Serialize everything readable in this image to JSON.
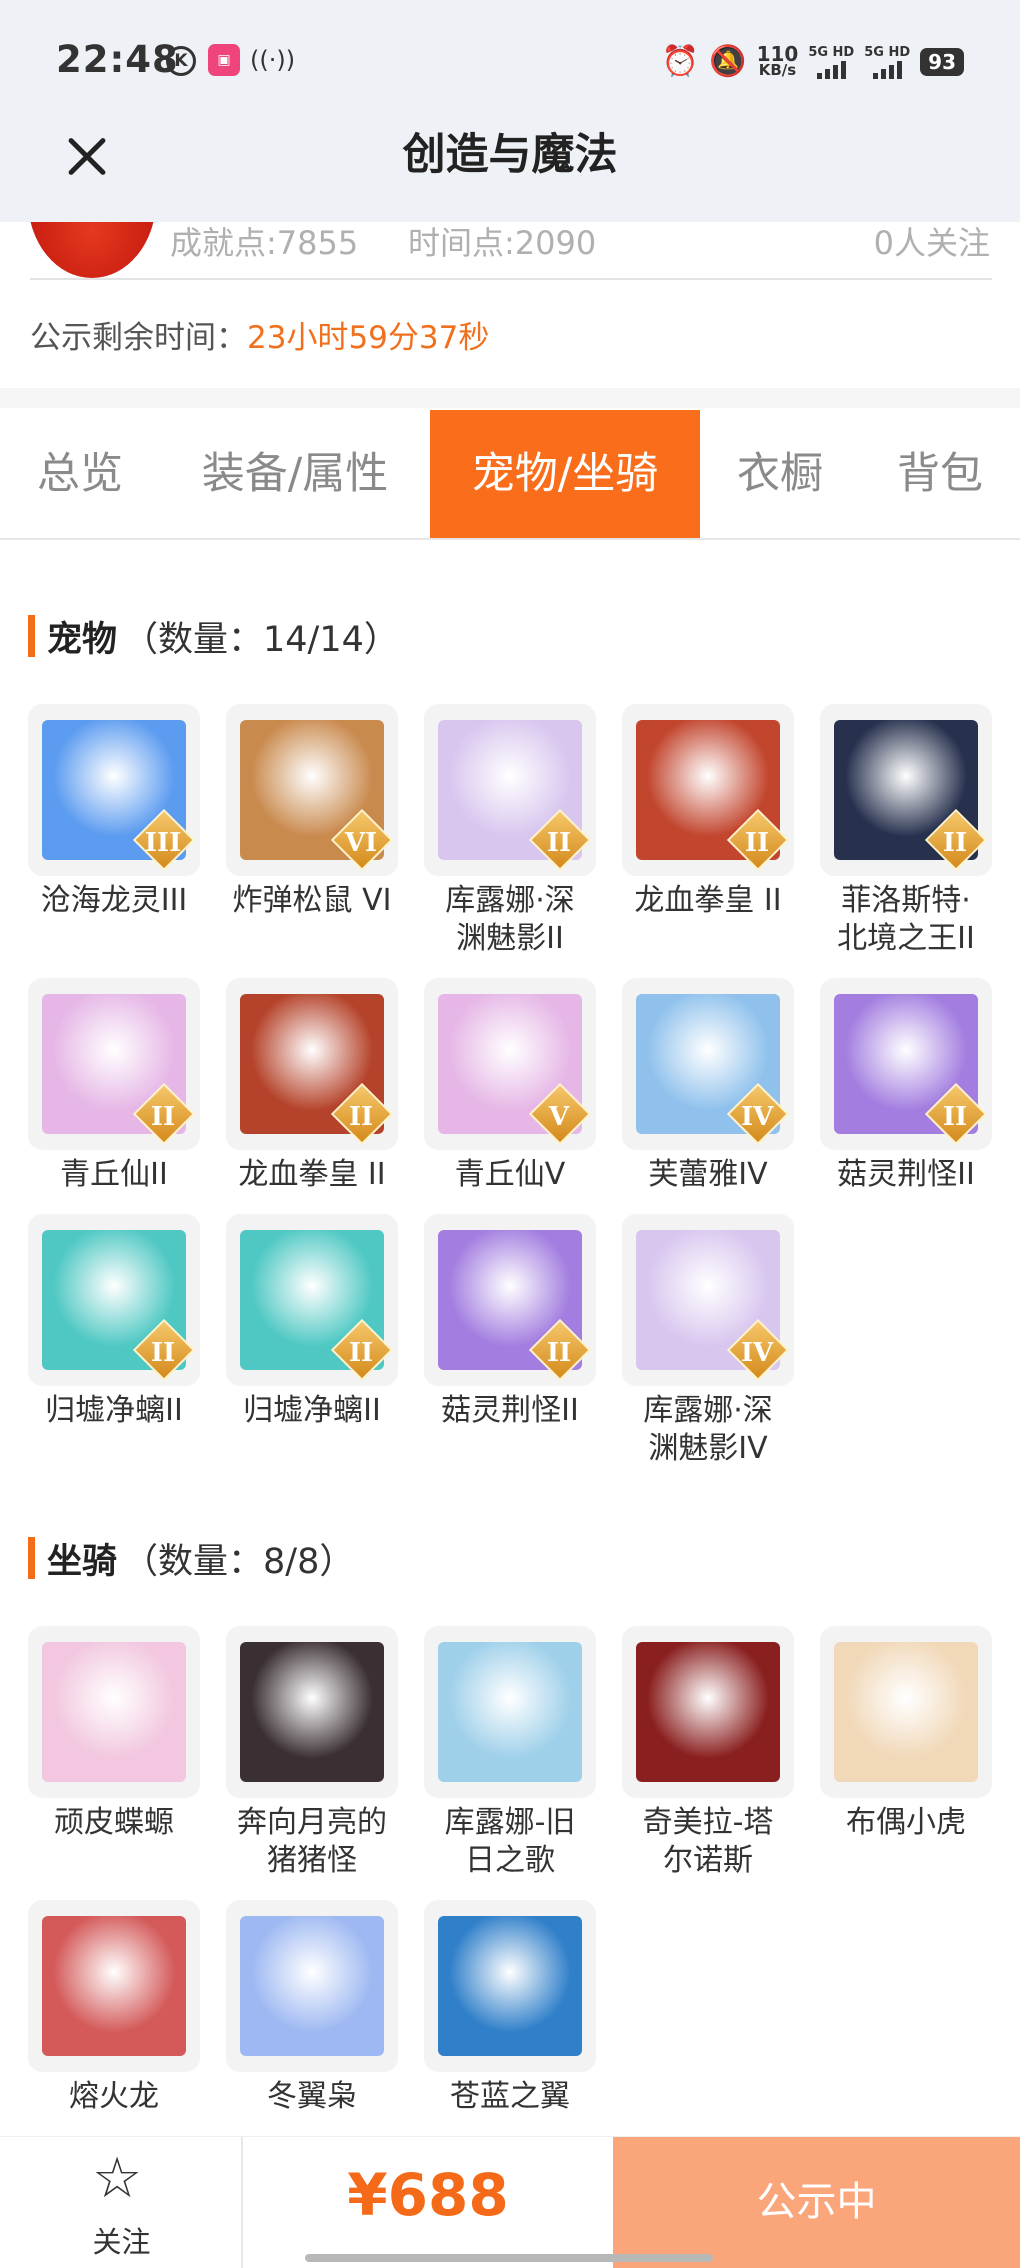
{
  "status_bar": {
    "time": "22:48",
    "k_icon": "K",
    "speed_value": "110",
    "speed_unit": "KB/s",
    "sig1": "5G HD",
    "sig2": "5G HD",
    "battery": "93",
    "icons": [
      "k-circle-icon",
      "app-icon",
      "nfc-icon",
      "alarm-icon",
      "mute-icon",
      "signal-icon",
      "battery-icon"
    ]
  },
  "nav": {
    "title": "创造与魔法",
    "close_icon": "close-icon"
  },
  "seller": {
    "achievement": "成就点:7855",
    "time_points": "时间点:2090",
    "followers": "0人关注"
  },
  "notice": {
    "label": "公示剩余时间：",
    "value": "23小时59分37秒"
  },
  "tabs": [
    {
      "label": "总览"
    },
    {
      "label": "装备/属性"
    },
    {
      "label": "宠物/坐骑",
      "active": true
    },
    {
      "label": "衣橱"
    },
    {
      "label": "背包"
    }
  ],
  "pets": {
    "title": "宠物",
    "count": "（数量：14/14）",
    "items": [
      {
        "name": "沧海龙灵III",
        "badge": "III",
        "color": "#5b9bf0"
      },
      {
        "name": "炸弹松鼠 VI",
        "badge": "VI",
        "color": "#c98a4e"
      },
      {
        "name": "库露娜·深\n渊魅影II",
        "badge": "II",
        "color": "#d8c6ef"
      },
      {
        "name": "龙血拳皇 II",
        "badge": "II",
        "color": "#c2452e"
      },
      {
        "name": "菲洛斯特·\n北境之王II",
        "badge": "II",
        "color": "#27314e"
      },
      {
        "name": "青丘仙II",
        "badge": "II",
        "color": "#e6b7e6"
      },
      {
        "name": "龙血拳皇 II",
        "badge": "II",
        "color": "#b5432b"
      },
      {
        "name": "青丘仙V",
        "badge": "V",
        "color": "#e6b7e6"
      },
      {
        "name": "芙蕾雅IV",
        "badge": "IV",
        "color": "#8fc1ec"
      },
      {
        "name": "菇灵荆怪II",
        "badge": "II",
        "color": "#a37ee0"
      },
      {
        "name": "归墟净螭II",
        "badge": "II",
        "color": "#4fc8c3"
      },
      {
        "name": "归墟净螭II",
        "badge": "II",
        "color": "#4fc8c3"
      },
      {
        "name": "菇灵荆怪II",
        "badge": "II",
        "color": "#a37ee0"
      },
      {
        "name": "库露娜·深\n渊魅影IV",
        "badge": "IV",
        "color": "#d8c6ef"
      }
    ]
  },
  "mounts": {
    "title": "坐骑",
    "count": "（数量：8/8）",
    "items": [
      {
        "name": "顽皮蝶螈",
        "color": "#f2c7df"
      },
      {
        "name": "奔向月亮的\n猪猪怪",
        "color": "#3a2f33"
      },
      {
        "name": "库露娜-旧\n日之歌",
        "color": "#9fd0ea"
      },
      {
        "name": "奇美拉-塔\n尔诺斯",
        "color": "#8a1f1f"
      },
      {
        "name": "布偶小虎",
        "color": "#f1d8b8"
      },
      {
        "name": "熔火龙",
        "color": "#d45a5a"
      },
      {
        "name": "冬翼枭",
        "color": "#9db8f2"
      },
      {
        "name": "苍蓝之翼",
        "color": "#2f7fc9"
      }
    ]
  },
  "bottom_bar": {
    "follow_label": "关注",
    "star_icon": "star-outline-icon",
    "price": "¥688",
    "action_label": "公示中"
  }
}
